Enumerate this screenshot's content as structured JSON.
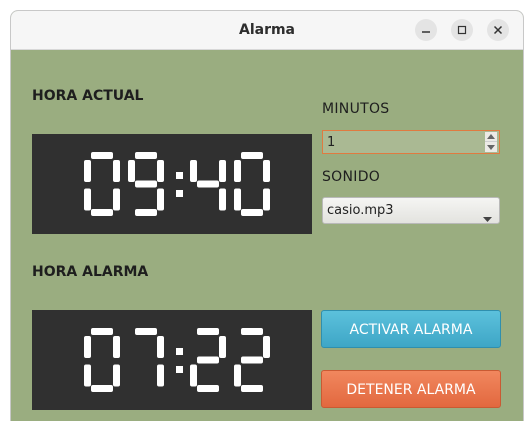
{
  "window": {
    "title": "Alarma",
    "controls": {
      "minimize": "minimize-icon",
      "maximize": "maximize-icon",
      "close": "close-icon"
    }
  },
  "current_time": {
    "label": "HORA ACTUAL",
    "value": "09:40"
  },
  "alarm_time": {
    "label": "HORA ALARMA",
    "value": "07:22"
  },
  "minutes": {
    "label": "MINUTOS",
    "value": "1"
  },
  "sound": {
    "label": "SONIDO",
    "selected": "casio.mp3"
  },
  "buttons": {
    "activate": "ACTIVAR ALARMA",
    "stop": "DETENER ALARMA"
  },
  "colors": {
    "background": "#9aad80",
    "clock_bg": "#303030",
    "digits": "#ffffff",
    "activate": "#4cb4d2",
    "stop": "#ea7449",
    "focus_border": "#e07a40"
  }
}
